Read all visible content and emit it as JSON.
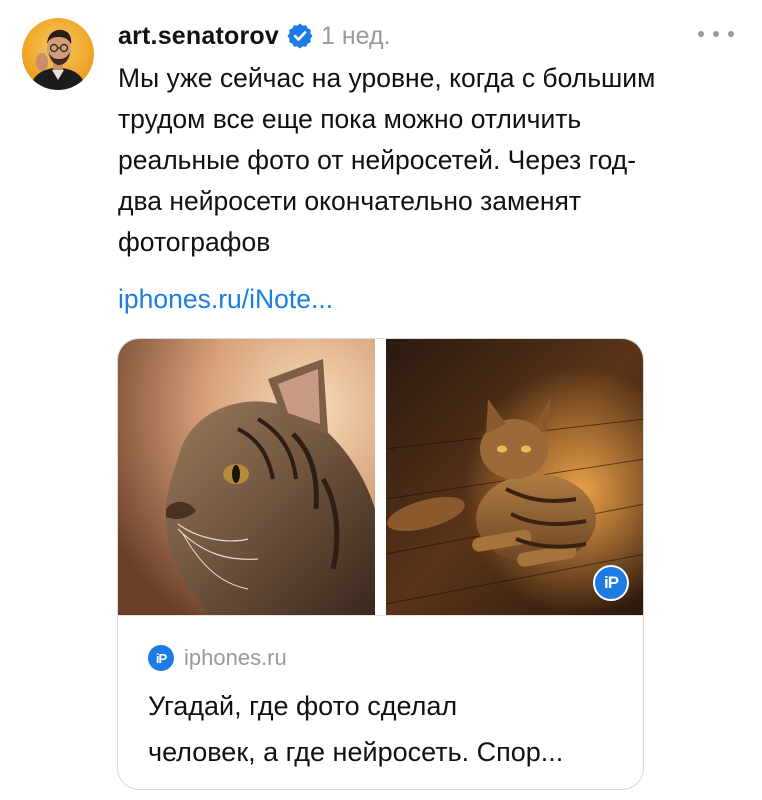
{
  "post": {
    "author": "art.senatorov",
    "verified": true,
    "time": "1 нед.",
    "text_lines": [
      "Мы уже сейчас на уровне, когда с большим",
      "трудом все еще пока можно отличить",
      "реальные фото от нейросетей. Через год-",
      "два нейросети окончательно заменят",
      "фотографов"
    ],
    "link": "iphones.ru/iNote..."
  },
  "card": {
    "images": [
      "cat-photo-closeup",
      "cat-photo-on-floor"
    ],
    "watermark": "iP",
    "source_icon": "iP",
    "source_name": "iphones.ru",
    "title_lines": [
      "Угадай, где фото сделал",
      "человек, а где нейросеть. Спор..."
    ]
  },
  "colors": {
    "link": "#1a7fe0",
    "verified_badge": "#1d7ce3",
    "muted": "#9a9a9a",
    "card_border": "#d9d9d9"
  },
  "icons": {
    "verified": "verified-check-icon",
    "more": "more-dots-icon",
    "source": "iphones-logo-icon"
  }
}
